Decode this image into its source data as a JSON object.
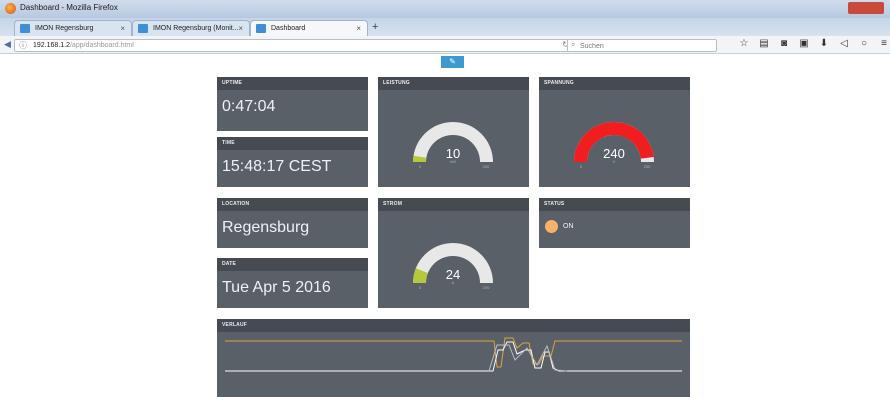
{
  "browser": {
    "window_title": "Dashboard - Mozilla Firefox",
    "tabs": [
      {
        "label": "IMON Regensburg"
      },
      {
        "label": "IMON Regensburg (Monit..."
      },
      {
        "label": "Dashboard"
      }
    ],
    "url_host": "192.168.1.2",
    "url_path": "/app/dashboard.html",
    "search_placeholder": "Suchen"
  },
  "dashboard": {
    "uptime": {
      "title": "UPTIME",
      "value": "0:47:04"
    },
    "time": {
      "title": "TIME",
      "value": "15:48:17 CEST"
    },
    "location": {
      "title": "LOCATION",
      "value": "Regensburg"
    },
    "date": {
      "title": "DATE",
      "value": "Tue Apr 5 2016"
    },
    "leistung": {
      "title": "LEISTUNG",
      "value": "10",
      "unit": "kW",
      "min": "0",
      "max": "200",
      "fraction": 0.05,
      "color": "#b5c93a"
    },
    "spannung": {
      "title": "SPANNUNG",
      "value": "240",
      "unit": "V",
      "min": "0",
      "max": "250",
      "fraction": 0.96,
      "color": "#f01e1e"
    },
    "strom": {
      "title": "STROM",
      "value": "24",
      "unit": "A",
      "min": "0",
      "max": "200",
      "fraction": 0.12,
      "color": "#b5c93a"
    },
    "status": {
      "title": "STATUS",
      "value": "ON",
      "color": "#f7b267"
    },
    "verlauf": {
      "title": "VERLAUF"
    }
  },
  "colors": {
    "widget_bg": "#5a6068",
    "widget_header": "#464b52",
    "gauge_track": "#e8e8e8",
    "accent": "#3d9ad1",
    "series_orange": "#e0a040",
    "series_white": "#ffffff"
  }
}
